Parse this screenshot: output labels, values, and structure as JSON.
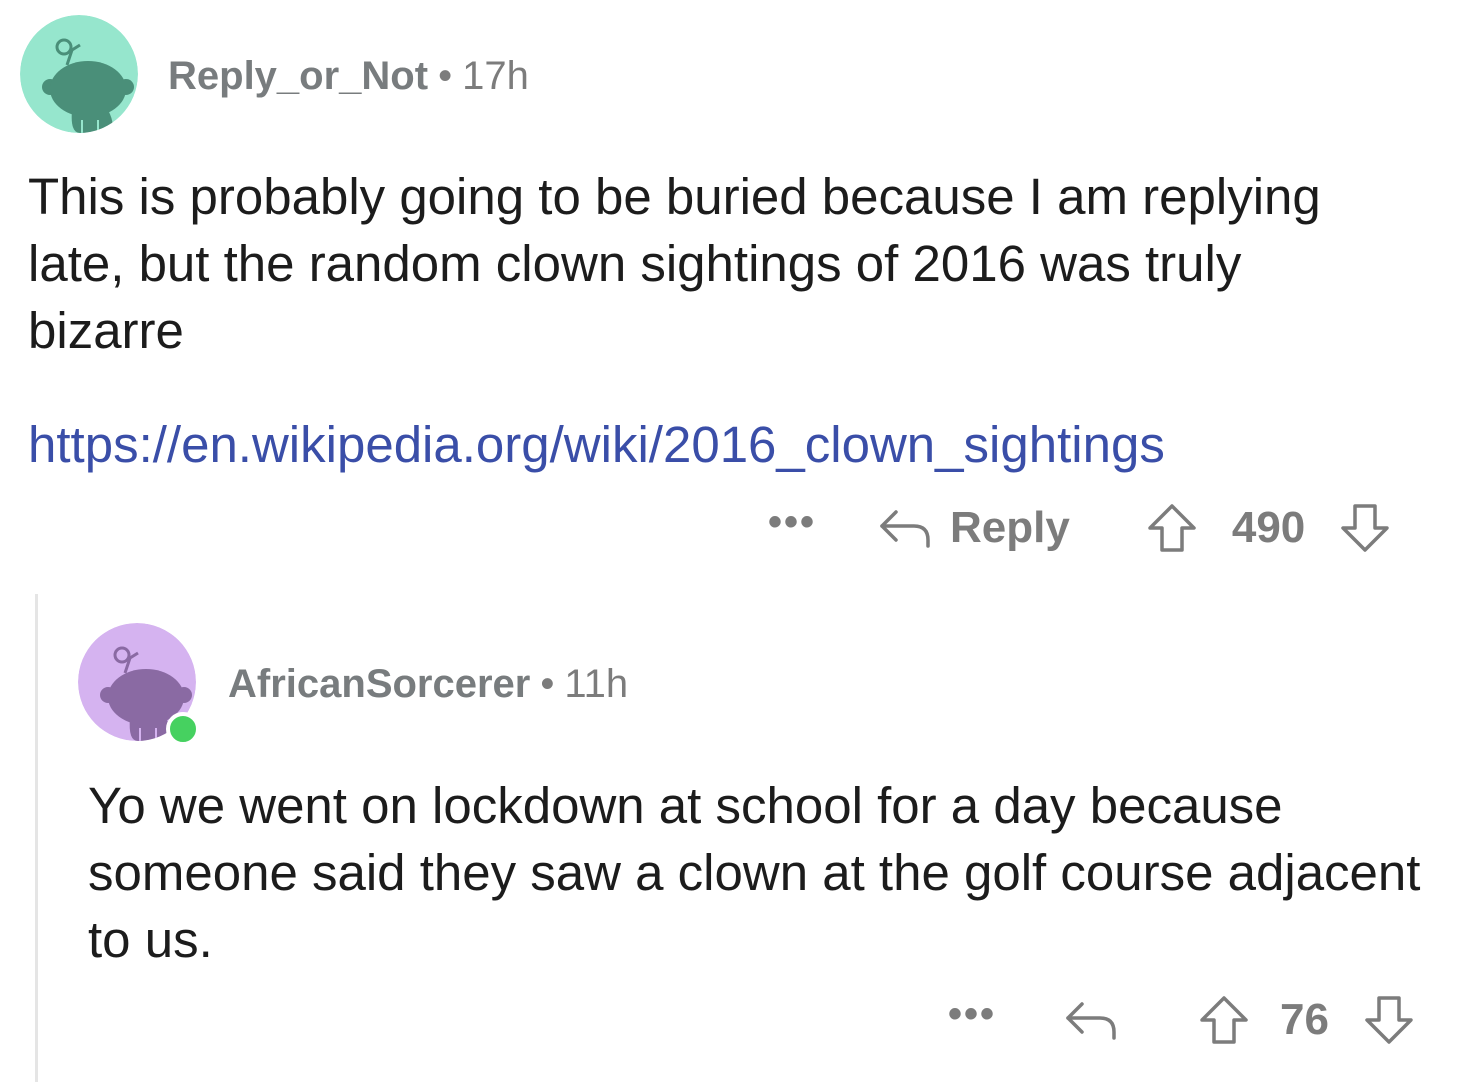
{
  "comments": [
    {
      "username": "Reply_or_Not",
      "separator": "•",
      "time": "17h",
      "body": "This is probably going to be buried because I am replying late, but the random clown sightings of 2016 was truly bizarre",
      "link": "https://en.wikipedia.org/wiki/2016_clown_sightings",
      "more_label": "•••",
      "reply_label": "Reply",
      "score": "490",
      "avatar_color": "#96e6cd",
      "avatar_figure_color": "#4a8f79"
    },
    {
      "username": "AfricanSorcerer",
      "separator": "•",
      "time": "11h",
      "body": "Yo we went on lockdown at school for a day because someone said they saw a clown at the golf course adjacent to us.",
      "more_label": "•••",
      "score": "76",
      "avatar_color": "#d5b3f0",
      "avatar_figure_color": "#8a6aa3",
      "online": true
    }
  ],
  "icons": {
    "more": "more-dots-icon",
    "reply": "reply-arrow-icon",
    "upvote": "upvote-arrow-icon",
    "downvote": "downvote-arrow-icon"
  },
  "colors": {
    "link": "#3a4ea8",
    "meta": "#7c7c7c",
    "online": "#46d160"
  }
}
